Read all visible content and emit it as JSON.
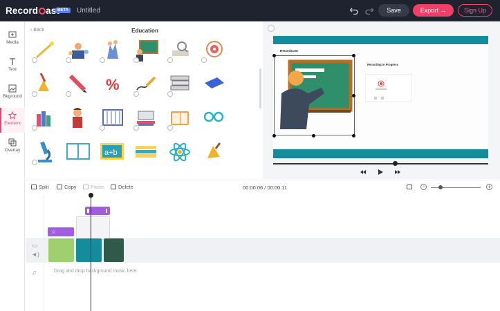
{
  "app": {
    "logo_text_a": "Record",
    "logo_text_b": "ast",
    "beta": "BETA",
    "doc_title": "Untitled"
  },
  "topbar": {
    "save_label": "Save",
    "export_label": "Export",
    "signup_label": "Sign Up"
  },
  "sidebar": {
    "items": [
      {
        "label": "Media",
        "icon": "media-icon"
      },
      {
        "label": "Text",
        "icon": "text-icon"
      },
      {
        "label": "Bkground",
        "icon": "background-icon"
      },
      {
        "label": "Element",
        "icon": "star-icon"
      },
      {
        "label": "Overlay",
        "icon": "overlay-icon"
      }
    ],
    "active": "Element"
  },
  "panel": {
    "back_label": "Back",
    "title": "Education",
    "elements": [
      "magic-wand-icon",
      "science-class-icon",
      "hands-up-icon",
      "teacher-board-icon",
      "magnifier-book-icon",
      "target-icon",
      "bell-icon",
      "pencil-icon",
      "percent-icon",
      "pencil-line-icon",
      "book-stack-icon",
      "blue-book-icon",
      "books-icon",
      "student-icon",
      "abacus-icon",
      "laptop-books-icon",
      "open-book-icon",
      "glasses-icon",
      "microscope-icon",
      "open-book-blue-icon",
      "math-board-icon",
      "pencils-icon",
      "atom-icon",
      "hand-bell-icon"
    ]
  },
  "preview": {
    "inner_logo": "RecordCast",
    "inner_heading": "Recording in Progress",
    "inner_caption": "00:00:00"
  },
  "toolbar": {
    "split_label": "Split",
    "copy_label": "Copy",
    "paste_label": "Paste",
    "delete_label": "Delete",
    "time_display": "00:00:06 / 00:00:11"
  },
  "timeline": {
    "music_hint": "Drag and drop background music here."
  },
  "colors": {
    "accent": "#f33f68",
    "topbar": "#1f2330",
    "teal": "#148c9c",
    "element_clip": "#a25ce0",
    "green_clip": "#9fcf6f"
  }
}
